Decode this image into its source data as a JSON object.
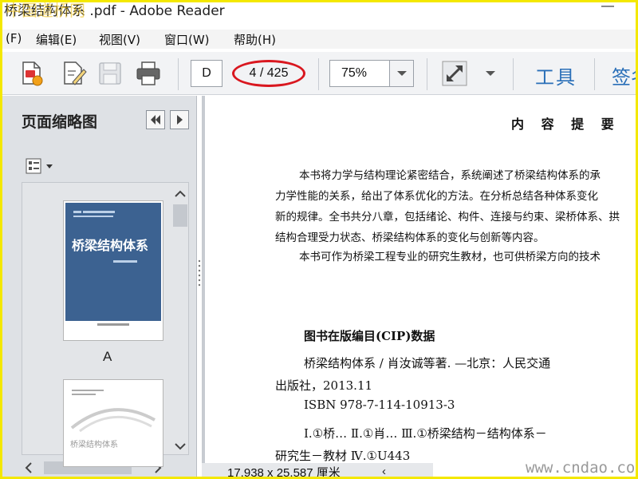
{
  "window": {
    "title": "桥梁结构体系 .pdf - Adobe Reader",
    "top_watermark": "中国道桥网",
    "minimize_glyph": "—"
  },
  "menu": [
    "(F)",
    "编辑(E)",
    "视图(V)",
    "窗口(W)",
    "帮助(H)"
  ],
  "toolbar": {
    "page_mode": "D",
    "page_indicator": "4 / 425",
    "zoom": "75%",
    "tools_label": "工具",
    "sign_label": "签名"
  },
  "colors": {
    "highlight_oval": "#d9171f",
    "frame": "#f4e800",
    "tools_text": "#2a6fb8",
    "cover": "#3c6291"
  },
  "left_panel": {
    "title": "页面缩略图",
    "thumbnails": [
      {
        "cover_title": "桥梁结构体系",
        "label": "A"
      },
      {
        "cover_title": "桥梁结构体系",
        "label": ""
      }
    ]
  },
  "document": {
    "heading": "内 容 提 要",
    "summary_lines": [
      "本书将力学与结构理论紧密结合，系统阐述了桥梁结构体系的承",
      "力学性能的关系，给出了体系优化的方法。在分析总结各种体系变化",
      "新的规律。全书共分八章，包括绪论、构件、连接与约束、梁桥体系、拱",
      "结构合理受力状态、桥梁结构体系的变化与创新等内容。",
      "本书可作为桥梁工程专业的研究生教材，也可供桥梁方向的技术"
    ],
    "cip_heading": "图书在版编目(CIP)数据",
    "cip_lines": [
      "桥梁结构体系 / 肖汝诚等著. —北京：人民交通",
      "出版社，2013.11",
      "ISBN 978-7-114-10913-3",
      "Ⅰ.①桥…    Ⅱ.①肖…    Ⅲ.①桥梁结构－结构体系－",
      "研究生－教材    Ⅳ.①U443"
    ]
  },
  "status_bar": {
    "page_size": "17.938 x 25.587 厘米"
  },
  "watermark": "www.cndao.com"
}
